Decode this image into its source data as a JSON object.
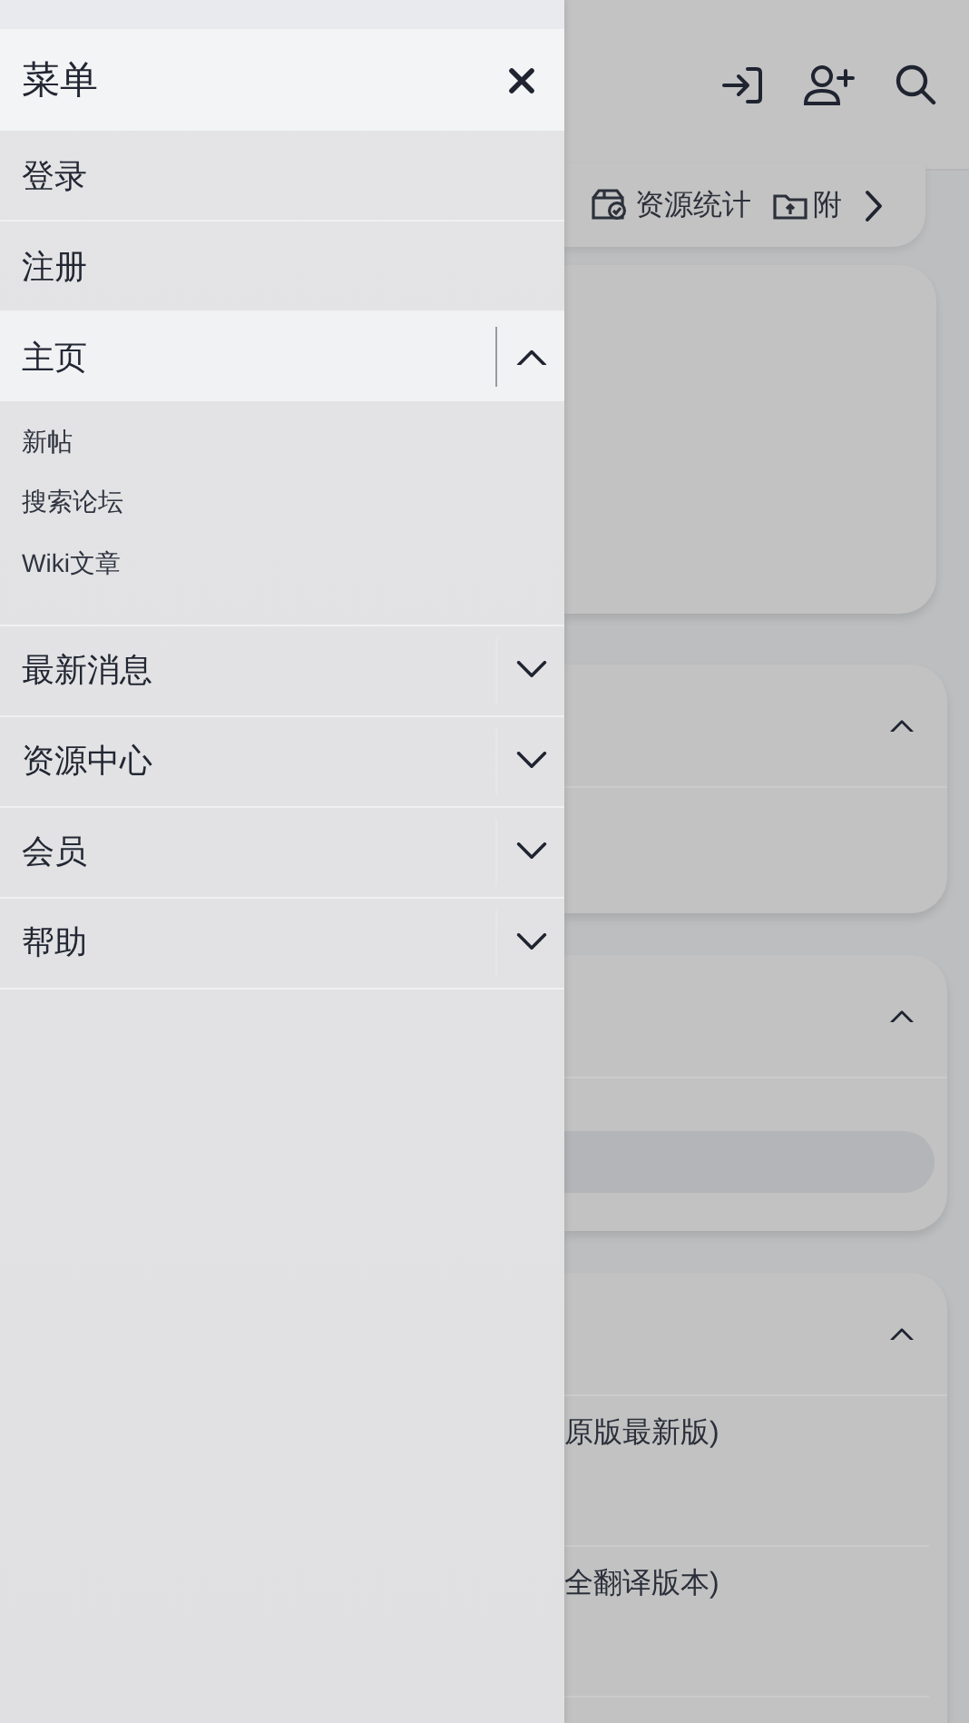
{
  "drawer": {
    "title": "菜单",
    "items": [
      {
        "label": "登录",
        "kind": "link"
      },
      {
        "label": "注册",
        "kind": "link"
      },
      {
        "label": "主页",
        "kind": "group",
        "expanded": true,
        "children": [
          {
            "label": "新帖"
          },
          {
            "label": "搜索论坛"
          },
          {
            "label": "Wiki文章"
          }
        ]
      },
      {
        "label": "最新消息",
        "kind": "group",
        "expanded": false
      },
      {
        "label": "资源中心",
        "kind": "group",
        "expanded": false
      },
      {
        "label": "会员",
        "kind": "group",
        "expanded": false
      },
      {
        "label": "帮助",
        "kind": "group",
        "expanded": false
      }
    ]
  },
  "page": {
    "tabs": [
      {
        "label": "资源统计",
        "kind": "stats"
      },
      {
        "label": "附",
        "kind": "upload"
      }
    ],
    "cards": [
      {
        "expanded": true,
        "rows": [
          {
            "kind": "blank"
          }
        ]
      },
      {
        "expanded": true,
        "rows": [
          {
            "kind": "bar"
          }
        ]
      },
      {
        "expanded": true,
        "rows": [
          {
            "kind": "text",
            "text": "原版最新版)"
          },
          {
            "kind": "text",
            "text": "全翻译版本)"
          }
        ]
      }
    ]
  }
}
